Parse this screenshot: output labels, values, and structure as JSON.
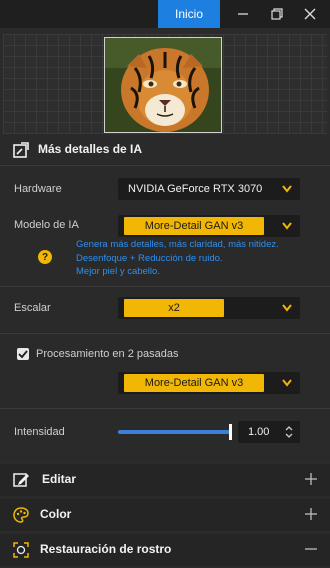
{
  "titlebar": {
    "start_label": "Inicio"
  },
  "section": {
    "title": "Más detalles de IA"
  },
  "hardware": {
    "label": "Hardware",
    "value": "NVIDIA GeForce RTX 3070"
  },
  "model": {
    "label": "Modelo de IA",
    "value": "More-Detail GAN  v3",
    "info_lines": [
      "Genera más detalles, más claridad, más nitidez.",
      "Desenfoque + Reducción de ruido.",
      "Mejor piel y cabello."
    ]
  },
  "scale": {
    "label": "Escalar",
    "value": "x2"
  },
  "two_pass": {
    "label": "Procesamiento en 2 pasadas",
    "checked": true,
    "value": "More-Detail GAN  v3"
  },
  "intensity": {
    "label": "Intensidad",
    "value": "1.00",
    "level": 1.0
  },
  "sections": [
    {
      "label": "Editar",
      "icon": "edit-icon",
      "state": "collapsed"
    },
    {
      "label": "Color",
      "icon": "palette-icon",
      "state": "collapsed"
    },
    {
      "label": "Restauración de rostro",
      "icon": "face-icon",
      "state": "expanded"
    }
  ],
  "colors": {
    "accent": "#f2b705",
    "primary": "#1d7fe0",
    "info": "#2f8ff0"
  }
}
